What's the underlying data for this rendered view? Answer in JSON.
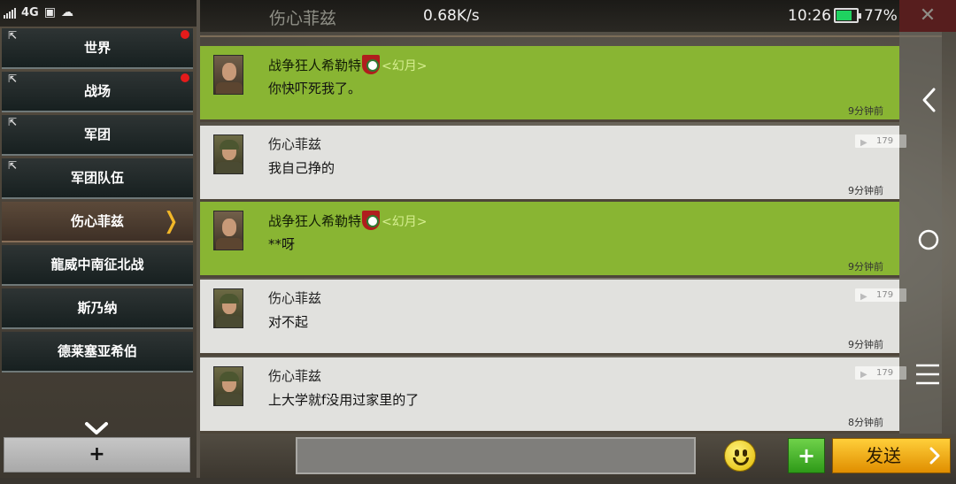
{
  "status_bar": {
    "network": "4G",
    "speed": "0.68K/s",
    "time": "10:26",
    "battery_level": 0.77,
    "battery_text": "77%"
  },
  "header": {
    "title": "伤心菲兹",
    "close_symbol": "✕"
  },
  "sidebar": {
    "channels": [
      {
        "label": "世界",
        "pinned": true,
        "unread": true
      },
      {
        "label": "战场",
        "pinned": true,
        "unread": true
      },
      {
        "label": "军团",
        "pinned": true,
        "unread": false
      },
      {
        "label": "军团队伍",
        "pinned": true,
        "unread": false
      },
      {
        "label": "伤心菲兹",
        "pinned": false,
        "unread": false,
        "active": true
      },
      {
        "label": "龍威中南征北战",
        "pinned": false,
        "unread": false
      },
      {
        "label": "斯乃纳",
        "pinned": false,
        "unread": false
      },
      {
        "label": "德莱塞亚希伯",
        "pinned": false,
        "unread": false
      }
    ],
    "active_marker": "❭",
    "expand_icon": "chevron-down-icon",
    "add_label": "+"
  },
  "messages": [
    {
      "sender": "战争狂人希勒特",
      "guild_open": "<",
      "guild": "幻月",
      "guild_close": ">",
      "text": "你快吓死我了。",
      "time": "9分钟前",
      "mine": true
    },
    {
      "sender": "伤心菲兹",
      "text": "我自己挣的",
      "time": "9分钟前",
      "rank": "179",
      "mine": false
    },
    {
      "sender": "战争狂人希勒特",
      "guild_open": "<",
      "guild": "幻月",
      "guild_close": ">",
      "text": "**呀",
      "time": "9分钟前",
      "mine": true
    },
    {
      "sender": "伤心菲兹",
      "text": "对不起",
      "time": "9分钟前",
      "rank": "179",
      "mine": false
    },
    {
      "sender": "伤心菲兹",
      "text": "上大学就f没用过家里的了",
      "time": "8分钟前",
      "rank": "179",
      "mine": false
    }
  ],
  "right_rail": {
    "icons": [
      "chevron-left-icon",
      "circle-icon",
      "menu-icon"
    ]
  },
  "input_bar": {
    "message_value": "",
    "emoji_icon": "smiley-icon",
    "plus_label": "+",
    "send_label": "发送"
  },
  "colors": {
    "own_message": "#89b533",
    "other_message": "#e1e1de",
    "unread_dot": "#e51b1b",
    "send_button": "#f2a91a"
  }
}
